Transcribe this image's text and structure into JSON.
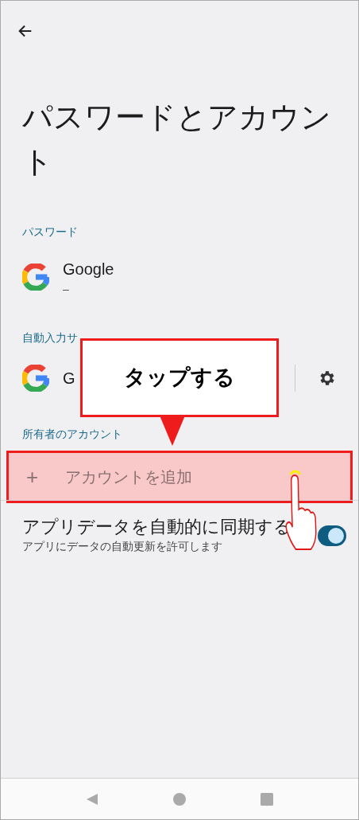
{
  "title": "パスワードとアカウント",
  "sections": [
    {
      "header": "パスワード",
      "items": [
        {
          "kind": "app",
          "title": "Google",
          "subtitle": "–"
        }
      ]
    },
    {
      "header": "自動入力サ",
      "items": [
        {
          "kind": "app_settings",
          "title": "G"
        }
      ]
    },
    {
      "header": "所有者のアカウント",
      "items": [
        {
          "kind": "add",
          "icon_text": "+",
          "label": "アカウントを追加"
        }
      ]
    }
  ],
  "sync": {
    "title": "アプリデータを自動的に同期する",
    "subtitle": "アプリにデータの自動更新を許可します",
    "on": true
  },
  "callout": {
    "text": "タップする"
  }
}
